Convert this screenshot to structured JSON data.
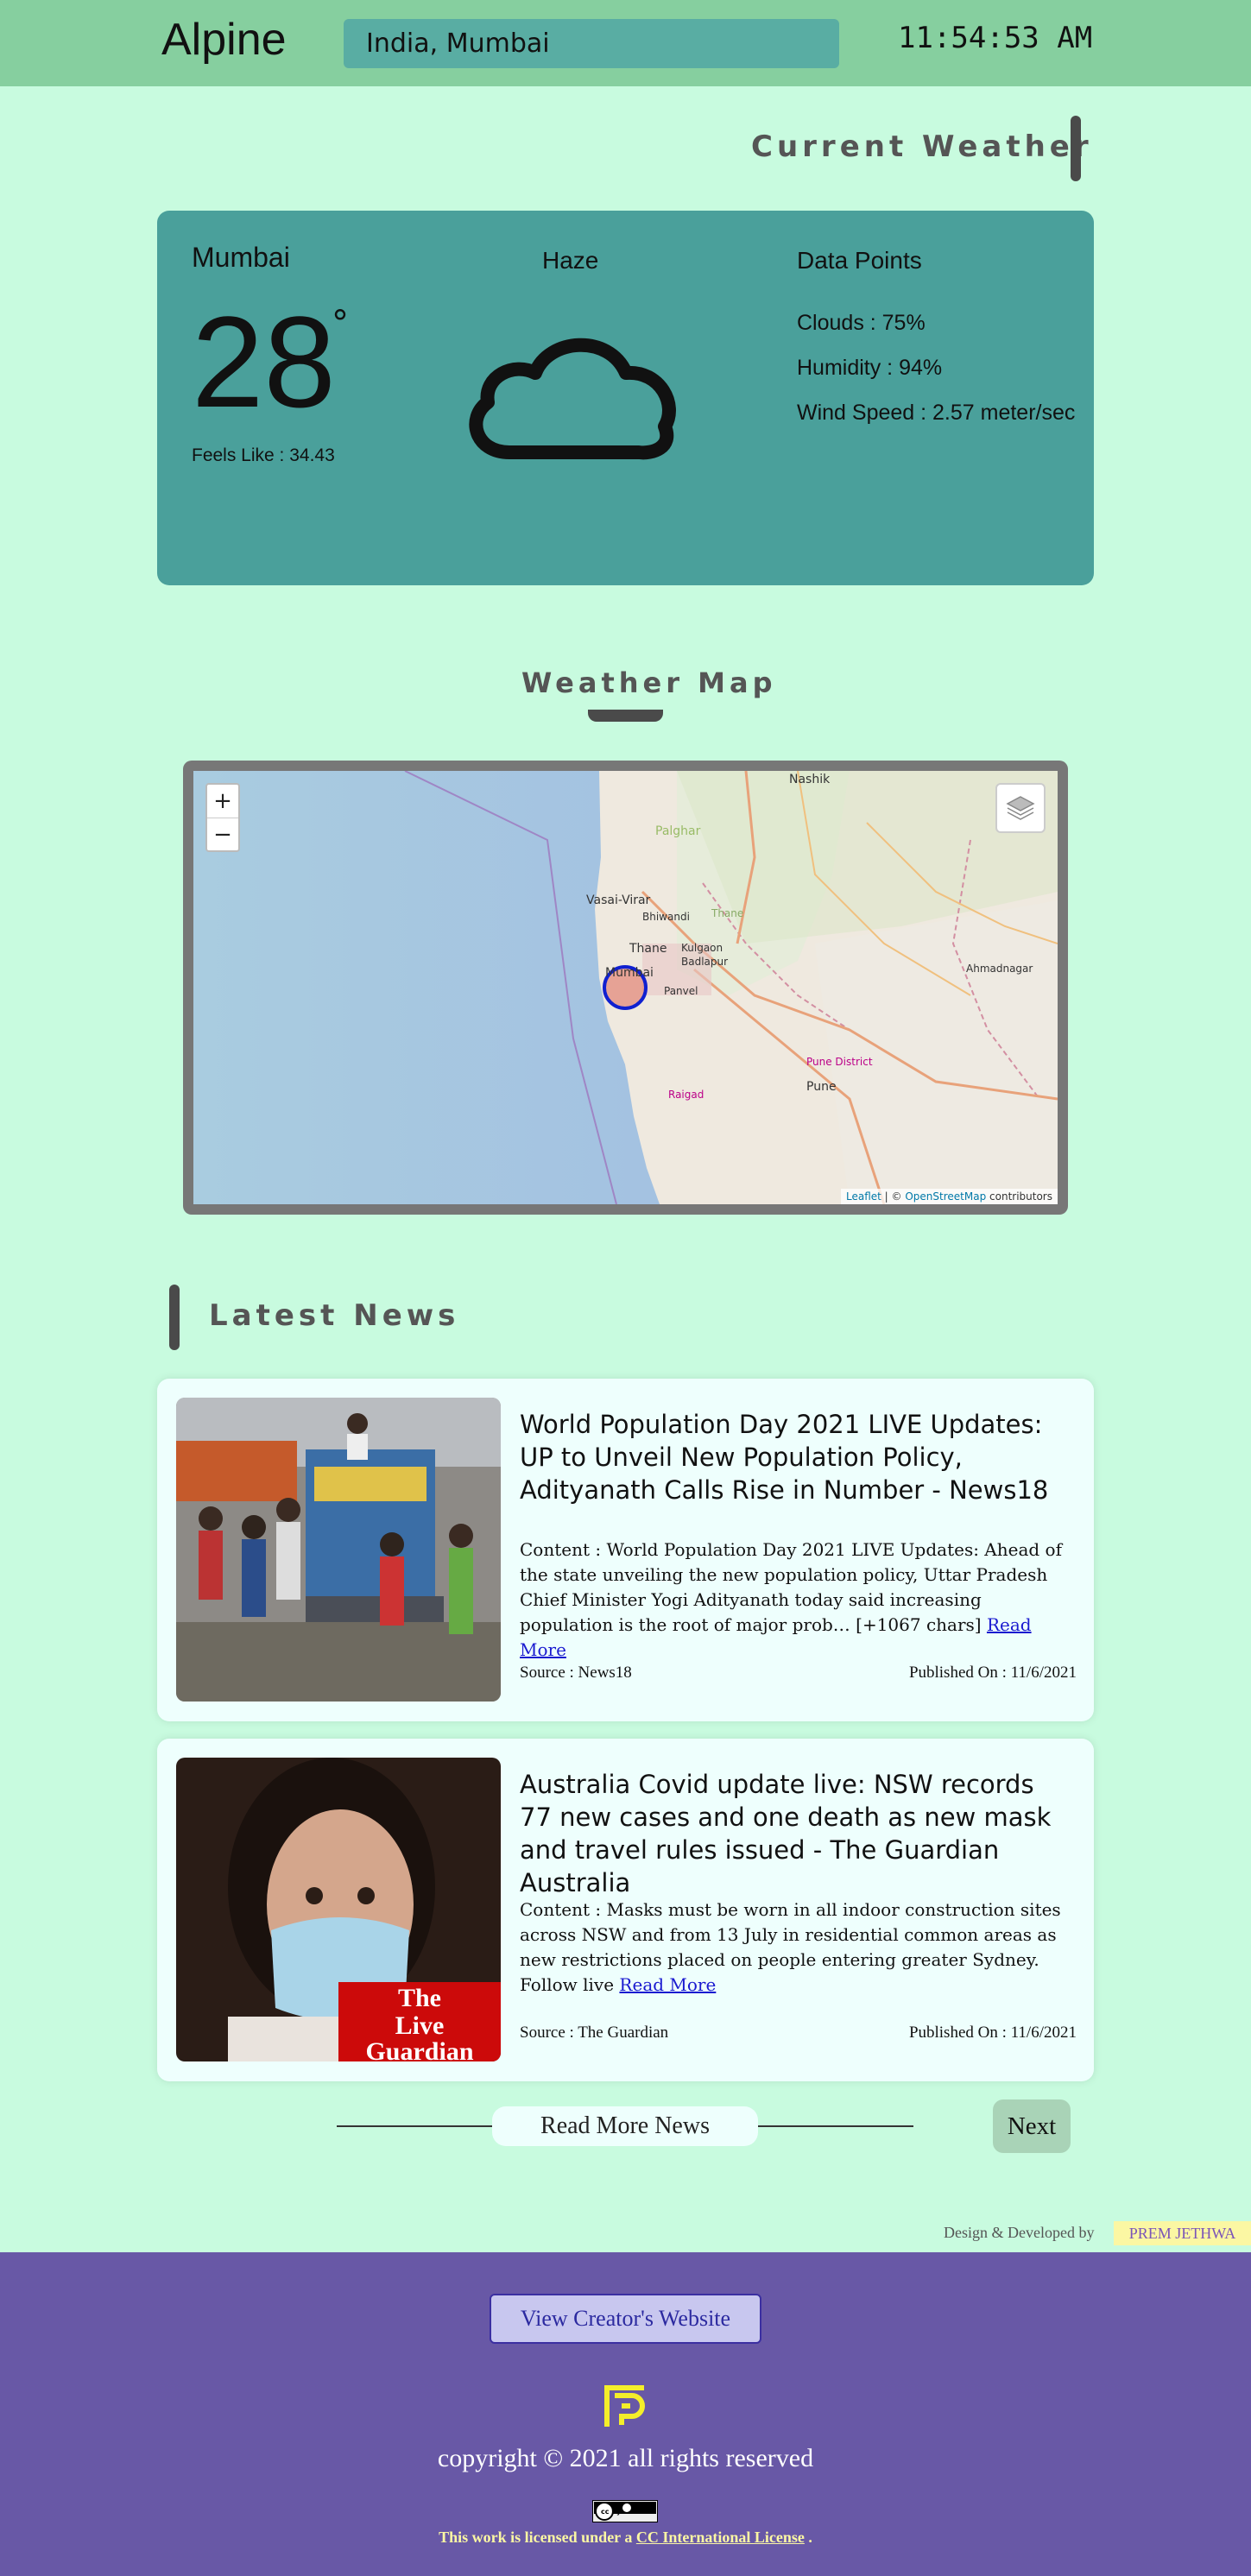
{
  "header": {
    "logo": "Alpine",
    "search_value": "India, Mumbai",
    "time": "11:54:53 AM"
  },
  "current_weather": {
    "section_title": "Current Weather",
    "city": "Mumbai",
    "temperature": "28",
    "degree_symbol": "°",
    "feels_like": "Feels Like : 34.43",
    "condition": "Haze",
    "condition_icon": "cloud-icon",
    "data_points_title": "Data Points",
    "clouds": "Clouds : 75%",
    "humidity": "Humidity : 94%",
    "wind_speed": "Wind Speed : 2.57 meter/sec"
  },
  "weather_map": {
    "section_title": "Weather Map",
    "zoom_in": "+",
    "zoom_out": "−",
    "labels": {
      "nashik": "Nashik",
      "palghar": "Palghar",
      "vasai_virar": "Vasai-Virar",
      "bhiwandi": "Bhiwandi",
      "thane_small": "Thane",
      "thane": "Thane",
      "kulgaon": "Kulgaon",
      "badlapur": "Badlapur",
      "mumbai": "Mumbai",
      "panvel": "Panvel",
      "ahmadnagar": "Ahmadnagar",
      "pune_district": "Pune District",
      "pune": "Pune",
      "raigad": "Raigad"
    },
    "attribution_leaflet": "Leaflet",
    "attribution_sep": " | © ",
    "attribution_osm": "OpenStreetMap",
    "attribution_tail": " contributors"
  },
  "news": {
    "section_title": "Latest News",
    "articles": [
      {
        "title": "World Population Day 2021 LIVE Updates: UP to Unveil New Population Policy, Adityanath Calls Rise in Number - News18",
        "content": "Content : World Population Day 2021 LIVE Updates: Ahead of the state unveiling the new population policy, Uttar Pradesh Chief Minister Yogi Adityanath today said increasing population is the root of major prob… [+1067 chars] ",
        "read_more": "Read More",
        "source": "Source : News18",
        "published": "Published On : 11/6/2021"
      },
      {
        "title": "Australia Covid update live: NSW records 77 new cases and one death as new mask and travel rules issued - The Guardian Australia",
        "content": "Content : Masks must be worn in all indoor construction sites across NSW and from 13 July in residential common areas as new restrictions placed on people entering greater Sydney. Follow live ",
        "read_more": "Read More",
        "source": "Source : The Guardian",
        "published": "Published On : 11/6/2021",
        "image_logo_line1": "The",
        "image_logo_line2": "Live Guardian"
      }
    ],
    "read_more_news": "Read More News",
    "next": "Next"
  },
  "credit": {
    "text": "Design & Developed by",
    "name": "PREM JETHWA"
  },
  "footer": {
    "creator_button": "View Creator's Website",
    "copyright": "copyright © 2021 all rights reserved",
    "cc_badge": "cc by",
    "license_prefix": "This work is licensed under a ",
    "license_link": "CC International License",
    "license_suffix": " ."
  },
  "colors": {
    "page_bg": "#c8fbdf",
    "header_bg": "#86cf9f",
    "search_bg": "#59ada3",
    "weather_card_bg": "#4aa09b",
    "news_card_bg": "#eefffd",
    "footer_bg": "#6858a6",
    "accent_yellow": "#fbf7a3"
  }
}
